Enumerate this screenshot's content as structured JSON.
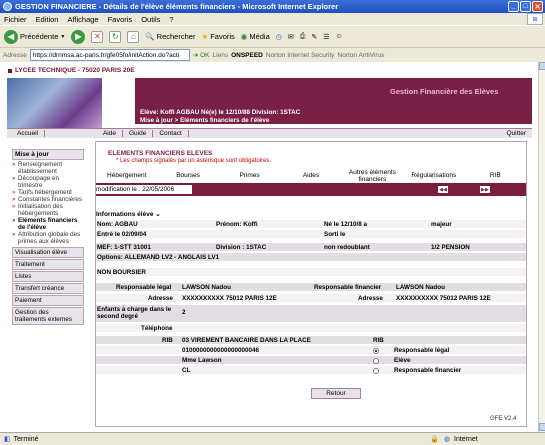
{
  "window": {
    "title": "GESTION FINANCIERE - Détails de l'élève éléments financiers - Microsoft Internet Explorer"
  },
  "menu": [
    "Fichier",
    "Edition",
    "Affichage",
    "Favoris",
    "Outils",
    "?"
  ],
  "toolbar": {
    "back": "Précédente",
    "search": "Rechercher",
    "favorites": "Favoris",
    "media": "Média"
  },
  "address": {
    "label": "Adresse",
    "url": "https://drnmsa.ac-paris.fr/gfe05fo/initAction.do?acti",
    "go": "OK",
    "links": "Liens",
    "onspeed": "ONSPEED",
    "norton_sec": "Norton Internet Security",
    "norton_av": "Norton AntiVirus"
  },
  "status": {
    "left": "Terminé",
    "zone": "Internet"
  },
  "header": {
    "school": "LYCEE TECHNIQUE - 75020 PARIS 20E",
    "app_title": "Gestion Financière des Elèves",
    "student": "Elève: Koffi AGBAU  Né(e) le 12/10/88   Division: 1STAC",
    "breadcrumb": "Mise à jour  >  Eléments financiers de l'élève"
  },
  "topnav": [
    "Accueil",
    "Aide",
    "Guide",
    "Contact"
  ],
  "quit": "Quitter",
  "sidebar": {
    "section1": "Mise à jour",
    "items": [
      "Renseignement établissement",
      "Découpage en trimestre",
      "Tarifs hébergement",
      "Constantes financières",
      "Initialisation des hébergements",
      "Eléments financiers de l'élève",
      "Attribution globale des primes aux élèves"
    ],
    "groups": [
      "Visualisation élève",
      "Traitement",
      "Listes",
      "Transfert créance",
      "Paiement",
      "Gestion des traitements externes"
    ]
  },
  "main": {
    "heading": "ELEMENTS FINANCIERS ELEVES",
    "required": "* Les champs signalés par un astérisque sont obligatoires.",
    "tabs": [
      "Hébergement",
      "Bourses",
      "Primes",
      "Aides",
      "Autres éléments financiers",
      "Régularisations",
      "RIB"
    ],
    "modif": "modification le : 22/05/2006",
    "info_title": "Informations élève",
    "return": "Retour"
  },
  "info": {
    "nom": "Nom: AGBAU",
    "prenom": "Prénom: Koffi",
    "ne": "Né le 12/10/8 a",
    "majeur": "majeur",
    "entre": "Entré le 02/09/04",
    "sortie": "Sorti le",
    "mef": "MEF: 1-STT 31001",
    "division": "Division : 1STAC",
    "redoublant": "non redoublant",
    "pension": "1/2 PENSION",
    "options": "Options: ALLEMAND LV2 - ANGLAIS LV1",
    "boursier": "NON BOURSIER"
  },
  "resp": {
    "legal_label": "Responsable légal",
    "legal_name": "LAWSON Nadou",
    "fin_label": "Responsable financier",
    "fin_name": "LAWSON Nadou",
    "adr_label": "Adresse",
    "adr_legal": "XXXXXXXXXX 75012 PARIS 12E",
    "adr_fin": "XXXXXXXXXX 75012 PARIS 12E",
    "enfants_label": "Enfants à charge dans le second degré",
    "enfants": "2",
    "tel_label": "Téléphone",
    "rib_label": "RIB",
    "rib_bank": "03 VIREMENT BANCAIRE DANS LA PLACE",
    "rib_label2": "RIB",
    "rib_num": "0100000000000000000046",
    "rib_name": "Mme Lawson",
    "rib_cl": "CL",
    "opt1": "Responsable légal",
    "opt2": "Elève",
    "opt3": "Responsable financier"
  },
  "version": "GFE V2.4"
}
